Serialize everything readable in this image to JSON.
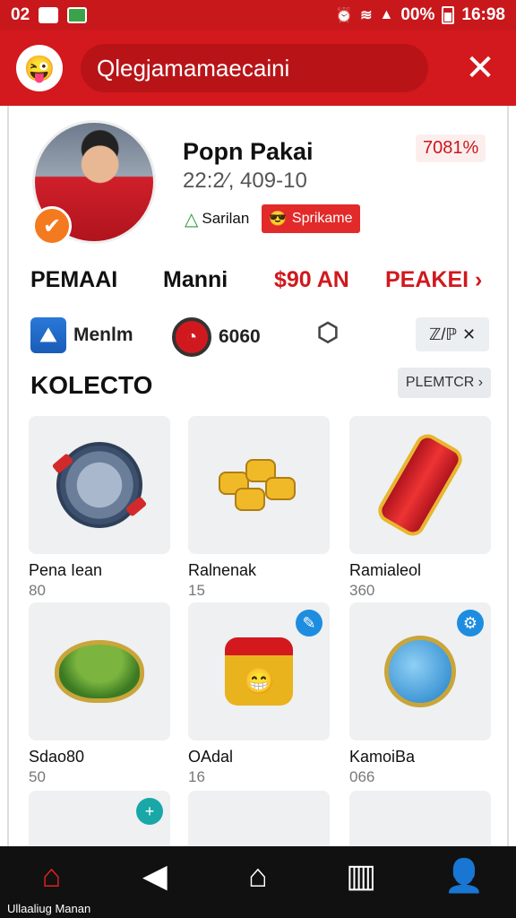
{
  "status_bar": {
    "left_text": "02",
    "battery_percent": "00%",
    "time": "16:98"
  },
  "header": {
    "search_value": "Qlegjamamaecaini",
    "close_icon": "close-icon"
  },
  "profile": {
    "name": "Popn Pakai",
    "subtitle": "22:2⁄, 409-10",
    "percent": "7081%",
    "tag_green": "Sarilan",
    "tag_red": "Sprikame"
  },
  "stats": [
    "PEMAAI",
    "Manni",
    "$90 AN",
    "PEAKEI ›"
  ],
  "icon_row": {
    "item1": "Menlm",
    "item2": "6060",
    "action": "ℤ/ℙ"
  },
  "collection": {
    "title": "KOLECTO",
    "see_more": "PLEMTCR ›",
    "items": [
      {
        "name": "Pena Iean",
        "count": "80"
      },
      {
        "name": "Ralnenak",
        "count": "15"
      },
      {
        "name": "Ramialeol",
        "count": "360"
      },
      {
        "name": "Sdao80",
        "count": "50"
      },
      {
        "name": "OAdal",
        "count": "16"
      },
      {
        "name": "KamoiBa",
        "count": "066"
      }
    ]
  },
  "bottom_nav": {
    "caption": "Ullaaliug Manan"
  },
  "colors": {
    "brand_red": "#d3191e",
    "nav_bg": "#111111"
  }
}
